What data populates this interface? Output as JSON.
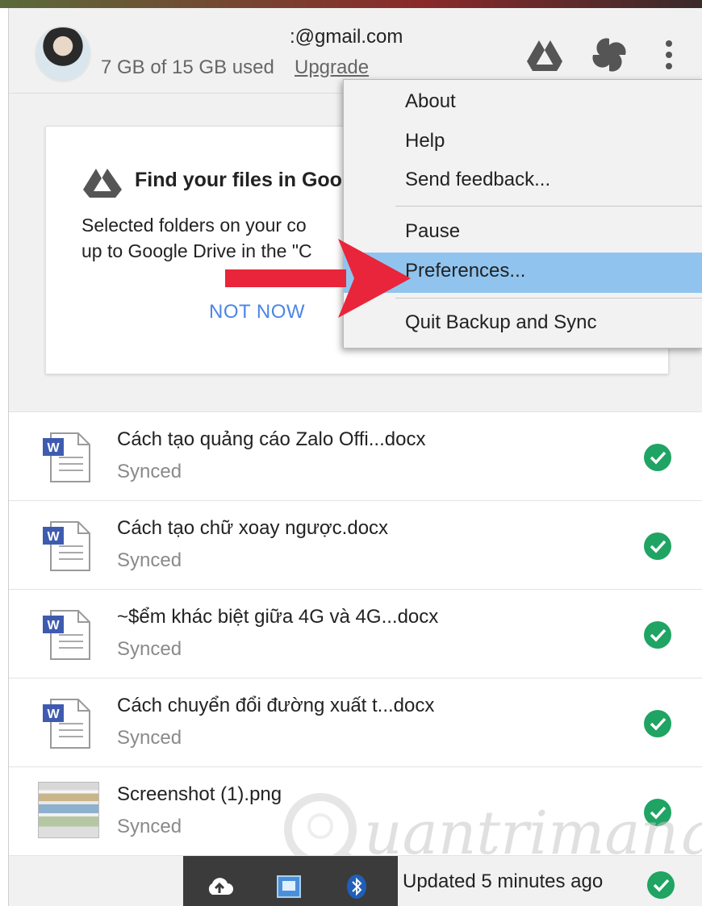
{
  "account": {
    "email": ":@gmail.com",
    "usage": "7 GB of 15 GB used",
    "upgrade_label": "Upgrade"
  },
  "header_icons": [
    "google-drive-icon",
    "google-photos-icon",
    "more-vert-icon"
  ],
  "card": {
    "title": "Find your files in Goo",
    "body_line1": "Selected folders on your co",
    "body_line2": "up to Google Drive in the \"C",
    "dismiss_label": "NOT NOW"
  },
  "menu": {
    "items": [
      {
        "label": "About"
      },
      {
        "label": "Help"
      },
      {
        "label": "Send feedback..."
      },
      {
        "label": "Pause"
      },
      {
        "label": "Preferences..."
      },
      {
        "label": "Quit Backup and Sync"
      }
    ],
    "selected": "Preferences..."
  },
  "files": [
    {
      "name": "Cách tạo quảng cáo Zalo Offi...docx",
      "status": "Synced",
      "type": "word-doc-icon"
    },
    {
      "name": "Cách tạo chữ xoay ngược.docx",
      "status": "Synced",
      "type": "word-doc-icon"
    },
    {
      "name": "~$ểm khác biệt giữa 4G và 4G...docx",
      "status": "Synced",
      "type": "word-doc-icon"
    },
    {
      "name": "Cách chuyển đổi đường xuất t...docx",
      "status": "Synced",
      "type": "word-doc-icon"
    },
    {
      "name": "Screenshot (1).png",
      "status": "Synced",
      "type": "image-thumbnail"
    }
  ],
  "footer": {
    "status": "Updated 5 minutes ago"
  },
  "watermark": "uantrimang",
  "colors": {
    "accent_blue": "#4b86e6",
    "menu_highlight": "#90c4ef",
    "sync_green": "#1fa463",
    "arrow_red": "#e8253a"
  }
}
